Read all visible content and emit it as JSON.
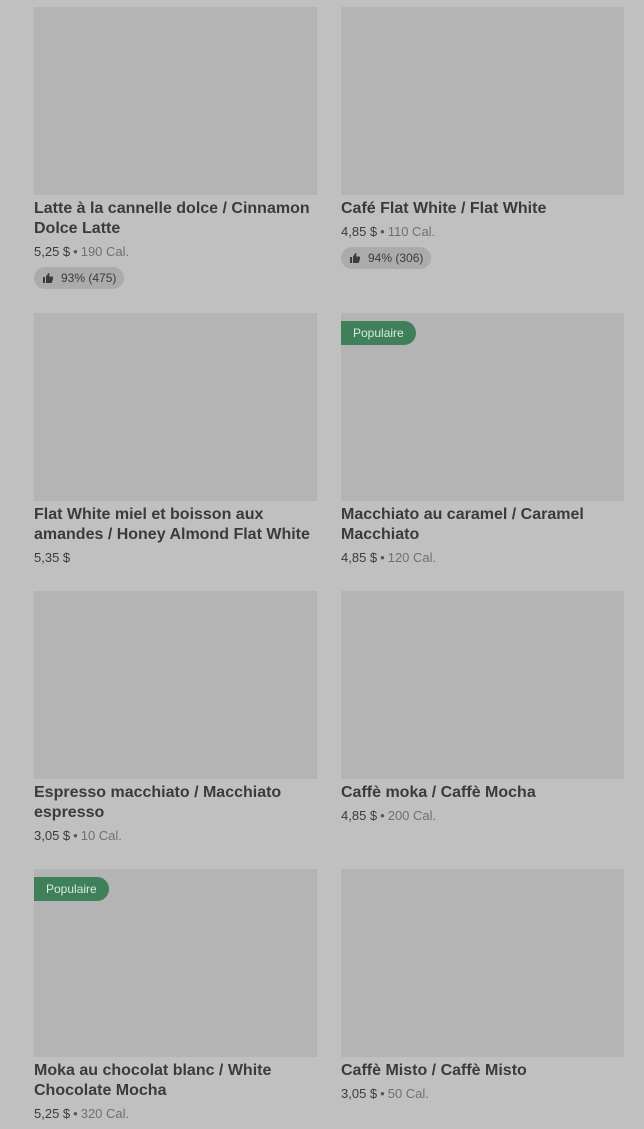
{
  "items": [
    {
      "name": "Latte à la cannelle dolce / Cinnamon Dolce Latte",
      "price": "5,25 $",
      "sep": "•",
      "cal": "190 Cal.",
      "rating": "93% (475)",
      "badge": ""
    },
    {
      "name": "Café Flat White / Flat White",
      "price": "4,85 $",
      "sep": "•",
      "cal": "110 Cal.",
      "rating": "94% (306)",
      "badge": ""
    },
    {
      "name": "Flat White miel et boisson aux amandes / Honey Almond Flat White",
      "price": "5,35 $",
      "sep": "",
      "cal": "",
      "rating": "",
      "badge": ""
    },
    {
      "name": "Macchiato au caramel / Caramel Macchiato",
      "price": "4,85 $",
      "sep": "•",
      "cal": "120 Cal.",
      "rating": "",
      "badge": "Populaire"
    },
    {
      "name": "Espresso macchiato / Macchiato espresso",
      "price": "3,05 $",
      "sep": "•",
      "cal": "10 Cal.",
      "rating": "",
      "badge": ""
    },
    {
      "name": "Caffè moka / Caffè Mocha",
      "price": "4,85 $",
      "sep": "•",
      "cal": "200 Cal.",
      "rating": "",
      "badge": ""
    },
    {
      "name": "Moka au chocolat blanc / White Chocolate Mocha",
      "price": "5,25 $",
      "sep": "•",
      "cal": "320 Cal.",
      "rating": "",
      "badge": "Populaire"
    },
    {
      "name": "Caffè Misto / Caffè Misto",
      "price": "3,05 $",
      "sep": "•",
      "cal": "50 Cal.",
      "rating": "",
      "badge": ""
    }
  ],
  "colors": {
    "overlay_bg": "#c0c0c0",
    "thumb": "#b4b4b4",
    "badge": "#3f7f5a"
  },
  "icons": {
    "rating": "thumbs-up-icon"
  }
}
